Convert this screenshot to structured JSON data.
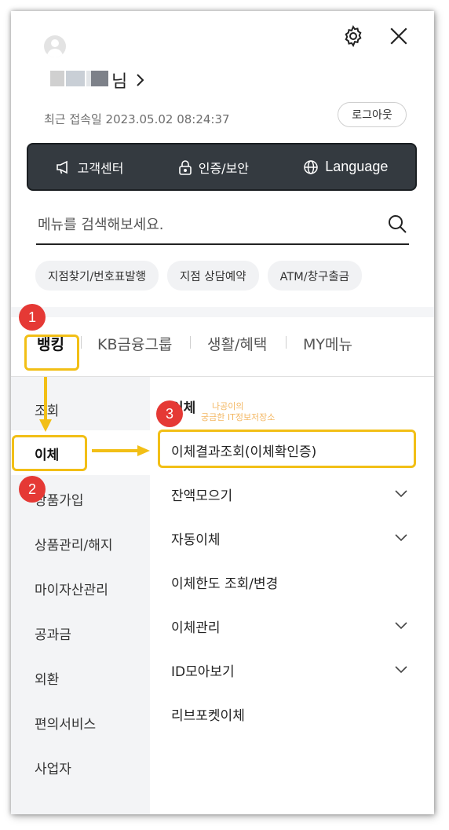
{
  "header": {
    "username_suffix": "님",
    "last_login": "최근 접속일 2023.05.02 08:24:37",
    "logout_label": "로그아웃"
  },
  "quickbar": {
    "items": [
      {
        "label": "고객센터",
        "icon": "megaphone-icon"
      },
      {
        "label": "인증/보안",
        "icon": "lock-icon"
      },
      {
        "label": "Language",
        "icon": "globe-icon"
      }
    ]
  },
  "search": {
    "placeholder": "메뉴를 검색해보세요.",
    "icon": "search-icon"
  },
  "chips": [
    "지점찾기/번호표발행",
    "지점 상담예약",
    "ATM/창구출금"
  ],
  "tabs": [
    "뱅킹",
    "KB금융그룹",
    "생활/혜택",
    "MY메뉴"
  ],
  "left_nav": [
    "조회",
    "이체",
    "상품가입",
    "상품관리/해지",
    "마이자산관리",
    "공과금",
    "외환",
    "편의서비스",
    "사업자"
  ],
  "submenu": {
    "header": "이체",
    "items": [
      {
        "label": "이체결과조회(이체확인증)",
        "expandable": false
      },
      {
        "label": "잔액모으기",
        "expandable": true
      },
      {
        "label": "자동이체",
        "expandable": true
      },
      {
        "label": "이체한도 조회/변경",
        "expandable": false
      },
      {
        "label": "이체관리",
        "expandable": true
      },
      {
        "label": "ID모아보기",
        "expandable": true
      },
      {
        "label": "리브포켓이체",
        "expandable": false
      }
    ]
  },
  "annotations": {
    "badges": [
      "1",
      "2",
      "3"
    ],
    "watermark_line1": "나공이의",
    "watermark_line2": "궁금한 IT정보저장소"
  },
  "colors": {
    "highlight": "#f2bf16",
    "badge": "#e53935",
    "darkbar": "#343a40"
  }
}
